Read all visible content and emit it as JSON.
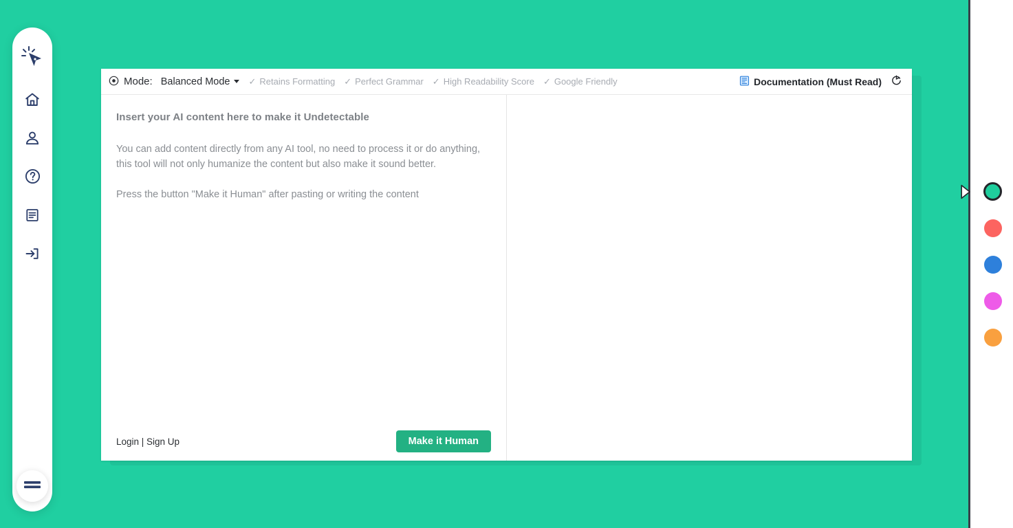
{
  "theme": {
    "background_green": "#20cfa1",
    "button_green": "#23b183",
    "accent_blue": "#2e80db",
    "panel_border": "#3a3f48"
  },
  "sidebar": {
    "logo_icon": "cursor-click-icon",
    "items": [
      {
        "icon": "home-icon",
        "name": "home"
      },
      {
        "icon": "user-icon",
        "name": "account"
      },
      {
        "icon": "question-circle-icon",
        "name": "help"
      },
      {
        "icon": "document-icon",
        "name": "documentation"
      },
      {
        "icon": "login-arrow-icon",
        "name": "login"
      }
    ],
    "menu_button_icon": "hamburger-menu-icon"
  },
  "toolbar": {
    "mode_icon": "radio-dot-icon",
    "mode_label": "Mode:",
    "mode_value": "Balanced Mode",
    "features": [
      {
        "check": "✓",
        "label": "Retains Formatting"
      },
      {
        "check": "✓",
        "label": "Perfect Grammar"
      },
      {
        "check": "✓",
        "label": "High Readability Score"
      },
      {
        "check": "✓",
        "label": "Google Friendly"
      }
    ],
    "documentation_icon": "blue-document-icon",
    "documentation_label": "Documentation (Must Read)",
    "reset_icon": "refresh-icon"
  },
  "editor": {
    "placeholder_title": "Insert your AI content here to make it Undetectable",
    "placeholder_paragraph_1": "You can add content directly from any AI tool, no need to process it or do anything, this tool will not only humanize the content but also make it sound better.",
    "placeholder_paragraph_2": "Press the button \"Make it Human\" after pasting or writing the content",
    "value": "",
    "auth_links": "Login | Sign Up",
    "submit_label": "Make it Human"
  },
  "output": {
    "value": ""
  },
  "right_panel": {
    "handle_icon": "chevron-right-icon",
    "swatches": [
      {
        "name": "green",
        "color": "#1fce9d",
        "selected": true
      },
      {
        "name": "red",
        "color": "#fc6460",
        "selected": false
      },
      {
        "name": "blue",
        "color": "#2e80db",
        "selected": false
      },
      {
        "name": "magenta",
        "color": "#ee5be8",
        "selected": false
      },
      {
        "name": "orange",
        "color": "#f9a03f",
        "selected": false
      }
    ]
  }
}
